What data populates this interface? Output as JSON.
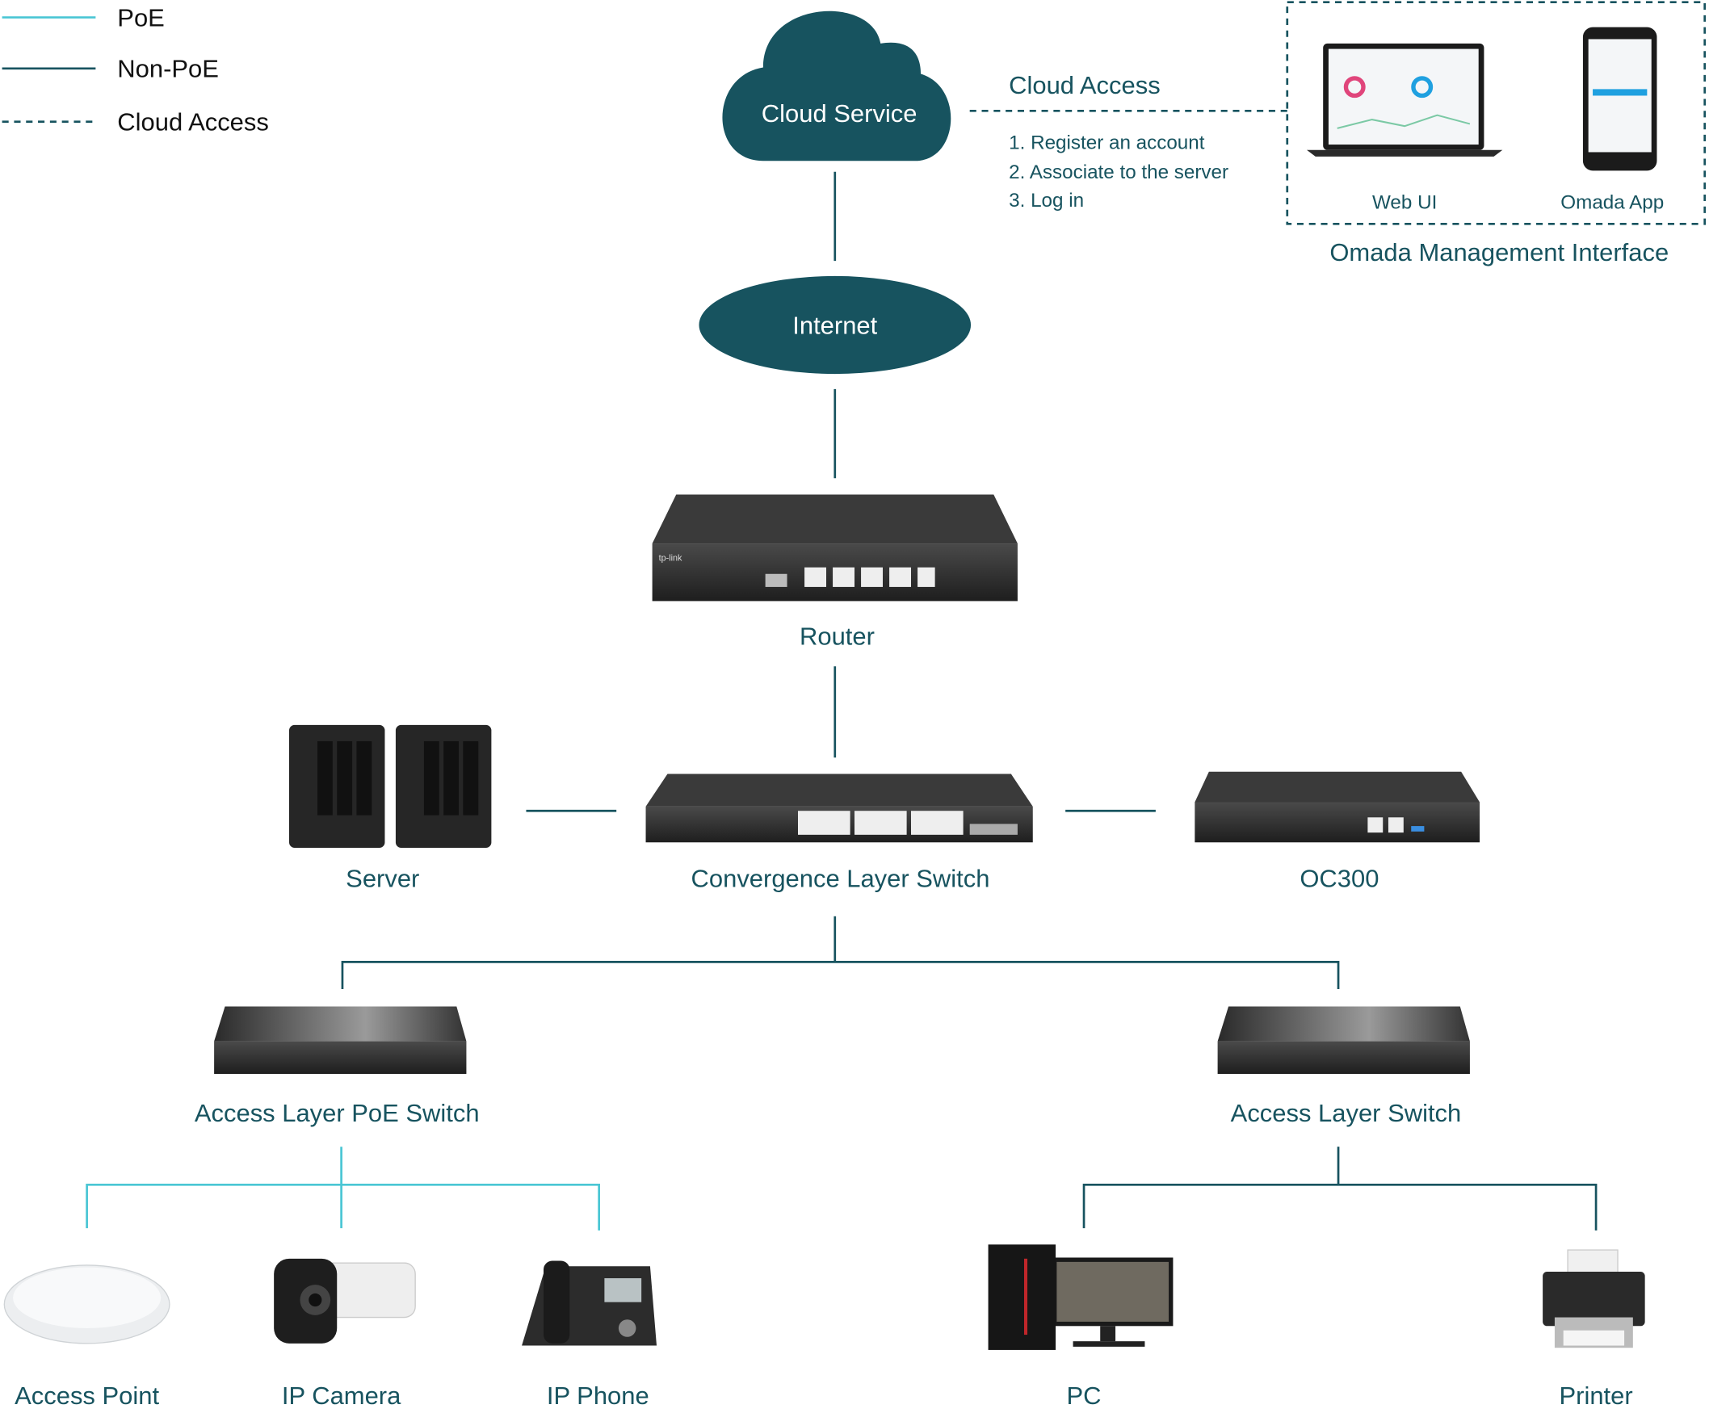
{
  "legend": {
    "poe": "PoE",
    "non_poe": "Non-PoE",
    "cloud_access": "Cloud Access"
  },
  "colors": {
    "primary": "#17535f",
    "poe": "#4ac6d4"
  },
  "cloud_service": "Cloud Service",
  "cloud_access": {
    "title": "Cloud Access",
    "steps": [
      "1. Register an account",
      "2. Associate to the server",
      "3. Log in"
    ]
  },
  "management": {
    "title": "Omada Management Interface",
    "web_ui": "Web UI",
    "app": "Omada App"
  },
  "internet": "Internet",
  "router": {
    "label": "Router",
    "brand": "tp-link"
  },
  "server": "Server",
  "core_switch": "Convergence Layer Switch",
  "controller": "OC300",
  "poe_switch": "Access Layer PoE Switch",
  "access_switch": "Access Layer Switch",
  "devices": {
    "ap": "Access Point",
    "camera": "IP Camera",
    "phone": "IP Phone",
    "pc": "PC",
    "printer": "Printer"
  }
}
